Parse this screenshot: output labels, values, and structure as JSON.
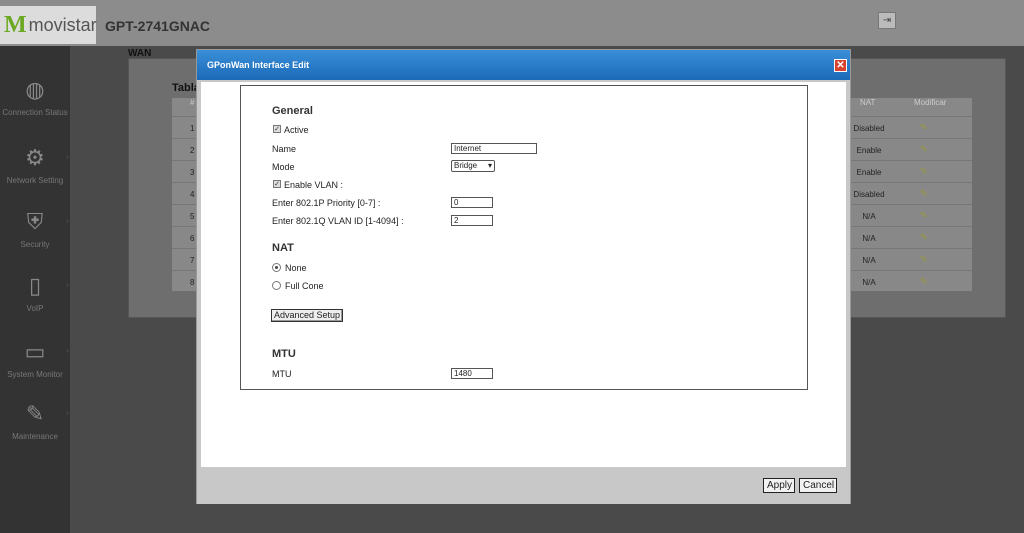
{
  "app": {
    "logo_mark": "M",
    "logo_text": "movistar",
    "model": "GPT-2741GNAC",
    "top_icon": "logout-icon"
  },
  "sidebar": {
    "items": [
      {
        "label": "Connection Status",
        "icon": "globe-icon"
      },
      {
        "label": "Network Setting",
        "icon": "gear-icon"
      },
      {
        "label": "Security",
        "icon": "shield-icon"
      },
      {
        "label": "VoIP",
        "icon": "phone-icon"
      },
      {
        "label": "System Monitor",
        "icon": "monitor-icon"
      },
      {
        "label": "Maintenance",
        "icon": "wrench-icon"
      }
    ]
  },
  "background": {
    "section_title": "WAN",
    "table_label": "Tabla",
    "columns": [
      "#",
      "NAT",
      "Modificar"
    ],
    "rows": [
      {
        "num": "1",
        "nat": "Disabled"
      },
      {
        "num": "2",
        "nat": "Enable"
      },
      {
        "num": "3",
        "nat": "Enable"
      },
      {
        "num": "4",
        "nat": "Disabled"
      },
      {
        "num": "5",
        "nat": "N/A"
      },
      {
        "num": "6",
        "nat": "N/A"
      },
      {
        "num": "7",
        "nat": "N/A"
      },
      {
        "num": "8",
        "nat": "N/A"
      }
    ]
  },
  "modal": {
    "title": "GPonWan Interface Edit",
    "close_label": "✕",
    "general": {
      "title": "General",
      "active_label": "Active",
      "active_checked": true,
      "name_label": "Name",
      "name_value": "Internet",
      "mode_label": "Mode",
      "mode_value": "Bridge",
      "enable_vlan_label": "Enable VLAN :",
      "enable_vlan_checked": true,
      "priority_label": "Enter 802.1P Priority [0-7] :",
      "priority_value": "0",
      "vlan_id_label": "Enter 802.1Q VLAN ID [1-4094] :",
      "vlan_id_value": "2"
    },
    "nat": {
      "title": "NAT",
      "none_label": "None",
      "full_cone_label": "Full Cone",
      "selected": "None"
    },
    "advanced_label": "Advanced Setup",
    "mtu": {
      "title": "MTU",
      "label": "MTU",
      "value": "1480"
    },
    "apply_label": "Apply",
    "cancel_label": "Cancel"
  }
}
